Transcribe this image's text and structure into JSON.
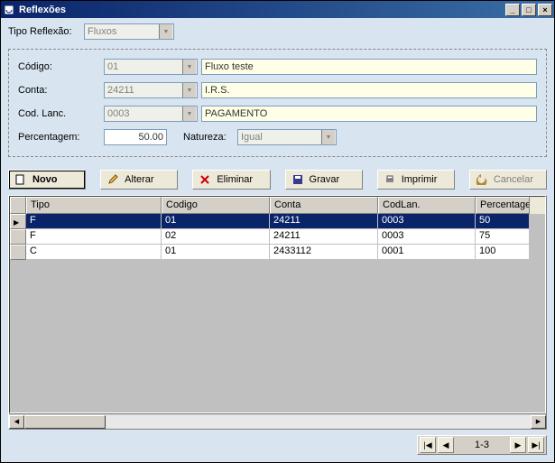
{
  "window": {
    "title": "Reflexões"
  },
  "top": {
    "tipo_reflexao_label": "Tipo Reflexão:",
    "tipo_reflexao_value": "Fluxos"
  },
  "form": {
    "codigo_label": "Código:",
    "codigo_value": "01",
    "codigo_desc": "Fluxo teste",
    "conta_label": "Conta:",
    "conta_value": "24211",
    "conta_desc": "I.R.S.",
    "codlanc_label": "Cod. Lanc.",
    "codlanc_value": "0003",
    "codlanc_desc": "PAGAMENTO",
    "percent_label": "Percentagem:",
    "percent_value": "50.00",
    "natureza_label": "Natureza:",
    "natureza_value": "Igual"
  },
  "toolbar": {
    "novo": "Novo",
    "alterar": "Alterar",
    "eliminar": "Eliminar",
    "gravar": "Gravar",
    "imprimir": "Imprimir",
    "cancelar": "Cancelar"
  },
  "grid": {
    "headers": {
      "tipo": "Tipo",
      "codigo": "Codigo",
      "conta": "Conta",
      "codlan": "CodLan.",
      "percent": "Percentage"
    },
    "rows": [
      {
        "tipo": "F",
        "codigo": "01",
        "conta": "24211",
        "codlan": "0003",
        "percent": "50",
        "selected": true
      },
      {
        "tipo": "F",
        "codigo": "02",
        "conta": "24211",
        "codlan": "0003",
        "percent": "75",
        "selected": false
      },
      {
        "tipo": "C",
        "codigo": "01",
        "conta": "2433112",
        "codlan": "0001",
        "percent": "100",
        "selected": false
      }
    ]
  },
  "nav": {
    "range": "1-3"
  }
}
